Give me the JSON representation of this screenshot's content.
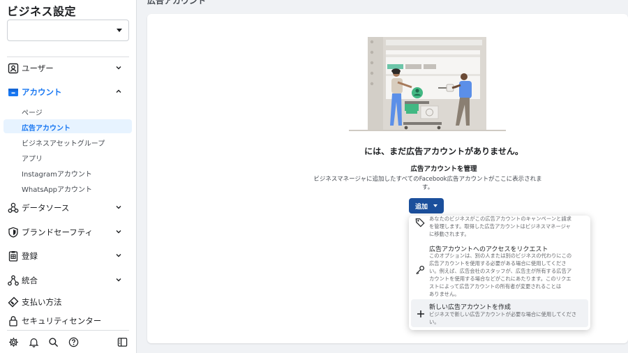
{
  "sidebar": {
    "title": "ビジネス設定",
    "business_selector_value": "",
    "nav": [
      {
        "label": "ユーザー",
        "icon": "user-card-icon"
      },
      {
        "label": "アカウント",
        "icon": "account-folder-icon"
      },
      {
        "label": "データソース",
        "icon": "data-source-icon"
      },
      {
        "label": "ブランドセーフティ",
        "icon": "shield-icon"
      },
      {
        "label": "登録",
        "icon": "register-clipboard-icon"
      },
      {
        "label": "統合",
        "icon": "integration-icon"
      },
      {
        "label": "支払い方法",
        "icon": "payment-tag-icon"
      },
      {
        "label": "セキュリティセンター",
        "icon": "lock-icon"
      }
    ],
    "account_sub": [
      {
        "label": "ページ"
      },
      {
        "label": "広告アカウント"
      },
      {
        "label": "ビジネスアセットグループ"
      },
      {
        "label": "アプリ"
      },
      {
        "label": "Instagramアカウント"
      },
      {
        "label": "WhatsAppアカウント"
      }
    ],
    "bottom_icons": [
      "settings-icon",
      "bell-icon",
      "search-icon",
      "help-icon",
      "panel-toggle-icon"
    ]
  },
  "main": {
    "header_cut": "広告アカウント",
    "empty_title": "には、まだ広告アカウントがありません。",
    "sub_title": "広告アカウントを管理",
    "description": "ビジネスマネージャに追加したすべてのFacebook広告アカウントがここに表示されます。",
    "add_button": "追加"
  },
  "dropdown": {
    "items": [
      {
        "title": "",
        "description_lines": [
          "あなたのビジネスがこの広告アカウントのキャンペーンと請求",
          "を管理します。取得した広告アカウントはビジネスマネージャ",
          "に移動されます。"
        ],
        "icon": "tag-icon"
      },
      {
        "title": "広告アカウントへのアクセスをリクエスト",
        "description_lines": [
          "このオプションは、別の人または別のビジネスの代わりにこの",
          "広告アカウントを使用する必要がある場合に使用してくださ",
          "い。例えば、広告会社のスタッフが、広告主が所有する広告ア",
          "カウントを使用する場合などがこれにあたります。このリクエ",
          "ストによって広告アカウントの所有者が変更されることは",
          "ありません。"
        ],
        "icon": "key-icon"
      },
      {
        "title": "新しい広告アカウントを作成",
        "description_lines": [
          "ビジネスで新しい広告アカウントが必要な場合に使用してくださ",
          "い。"
        ],
        "icon": "plus-icon"
      }
    ]
  },
  "colors": {
    "accent": "#1877f2",
    "button": "#1b4f9c",
    "selected_bg": "#e7f3ff",
    "illustration_green": "#42b883",
    "illustration_blue": "#5b8fe8"
  }
}
